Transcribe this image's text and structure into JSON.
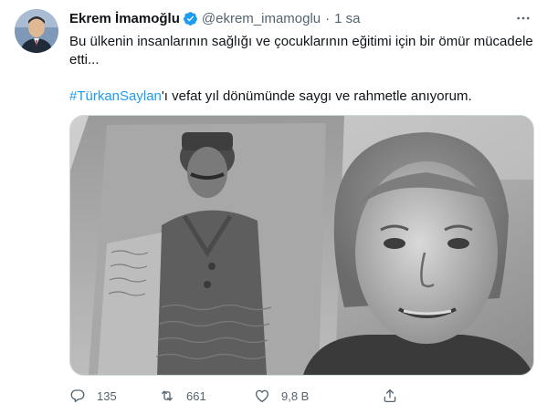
{
  "tweet": {
    "author_name": "Ekrem İmamoğlu",
    "handle": "@ekrem_imamoglu",
    "separator": "·",
    "time": "1 sa",
    "text_line1": "Bu ülkenin insanlarının sağlığı ve çocuklarının eğitimi için bir ömür mücadele",
    "text_line2": "etti...",
    "hashtag": "#TürkanSaylan",
    "text_after_hashtag": "'ı vefat yıl dönümünde saygı ve rahmetle anıyorum."
  },
  "actions": {
    "reply_count": "135",
    "retweet_count": "661",
    "like_count": "9,8 B"
  },
  "colors": {
    "accent": "#1d9bf0",
    "secondary_text": "#536471",
    "border": "#cfd9de"
  },
  "icons": [
    "verified-badge-icon",
    "more-options-icon",
    "reply-icon",
    "retweet-icon",
    "like-icon",
    "share-icon"
  ]
}
